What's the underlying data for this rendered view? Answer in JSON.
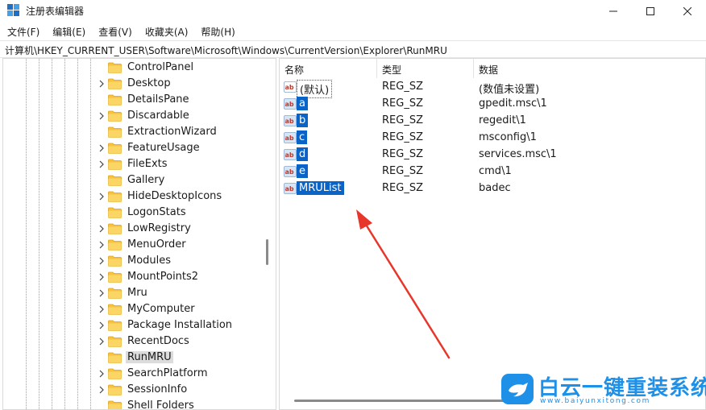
{
  "window": {
    "title": "注册表编辑器",
    "icon": "registry-editor-icon"
  },
  "menu": [
    "文件(F)",
    "编辑(E)",
    "查看(V)",
    "收藏夹(A)",
    "帮助(H)"
  ],
  "address": "计算机\\HKEY_CURRENT_USER\\Software\\Microsoft\\Windows\\CurrentVersion\\Explorer\\RunMRU",
  "tree": {
    "items": [
      {
        "label": "ControlPanel",
        "expandable": false
      },
      {
        "label": "Desktop",
        "expandable": true
      },
      {
        "label": "DetailsPane",
        "expandable": false
      },
      {
        "label": "Discardable",
        "expandable": true
      },
      {
        "label": "ExtractionWizard",
        "expandable": false
      },
      {
        "label": "FeatureUsage",
        "expandable": true
      },
      {
        "label": "FileExts",
        "expandable": true
      },
      {
        "label": "Gallery",
        "expandable": false
      },
      {
        "label": "HideDesktopIcons",
        "expandable": true
      },
      {
        "label": "LogonStats",
        "expandable": false
      },
      {
        "label": "LowRegistry",
        "expandable": true
      },
      {
        "label": "MenuOrder",
        "expandable": true
      },
      {
        "label": "Modules",
        "expandable": true
      },
      {
        "label": "MountPoints2",
        "expandable": true
      },
      {
        "label": "Mru",
        "expandable": true
      },
      {
        "label": "MyComputer",
        "expandable": true
      },
      {
        "label": "Package Installation",
        "expandable": true
      },
      {
        "label": "RecentDocs",
        "expandable": true
      },
      {
        "label": "RunMRU",
        "expandable": false,
        "selected": true
      },
      {
        "label": "SearchPlatform",
        "expandable": true
      },
      {
        "label": "SessionInfo",
        "expandable": true
      },
      {
        "label": "Shell Folders",
        "expandable": false
      }
    ]
  },
  "values": {
    "columns": [
      "名称",
      "类型",
      "数据"
    ],
    "rows": [
      {
        "name": "(默认)",
        "type": "REG_SZ",
        "data": "(数值未设置)",
        "default": true,
        "selected": false
      },
      {
        "name": "a",
        "type": "REG_SZ",
        "data": "gpedit.msc\\1",
        "selected": true
      },
      {
        "name": "b",
        "type": "REG_SZ",
        "data": "regedit\\1",
        "selected": true
      },
      {
        "name": "c",
        "type": "REG_SZ",
        "data": "msconfig\\1",
        "selected": true
      },
      {
        "name": "d",
        "type": "REG_SZ",
        "data": "services.msc\\1",
        "selected": true
      },
      {
        "name": "e",
        "type": "REG_SZ",
        "data": "cmd\\1",
        "selected": true
      },
      {
        "name": "MRUList",
        "type": "REG_SZ",
        "data": "badec",
        "selected": true
      }
    ]
  },
  "watermark": {
    "text": "白云一键重装系统",
    "url": "www.baiyunxitong.com"
  },
  "colors": {
    "selection": "#0a64c8",
    "folder": "#f6c244",
    "annotation_arrow": "#e8362a",
    "watermark": "#1e90e8"
  }
}
